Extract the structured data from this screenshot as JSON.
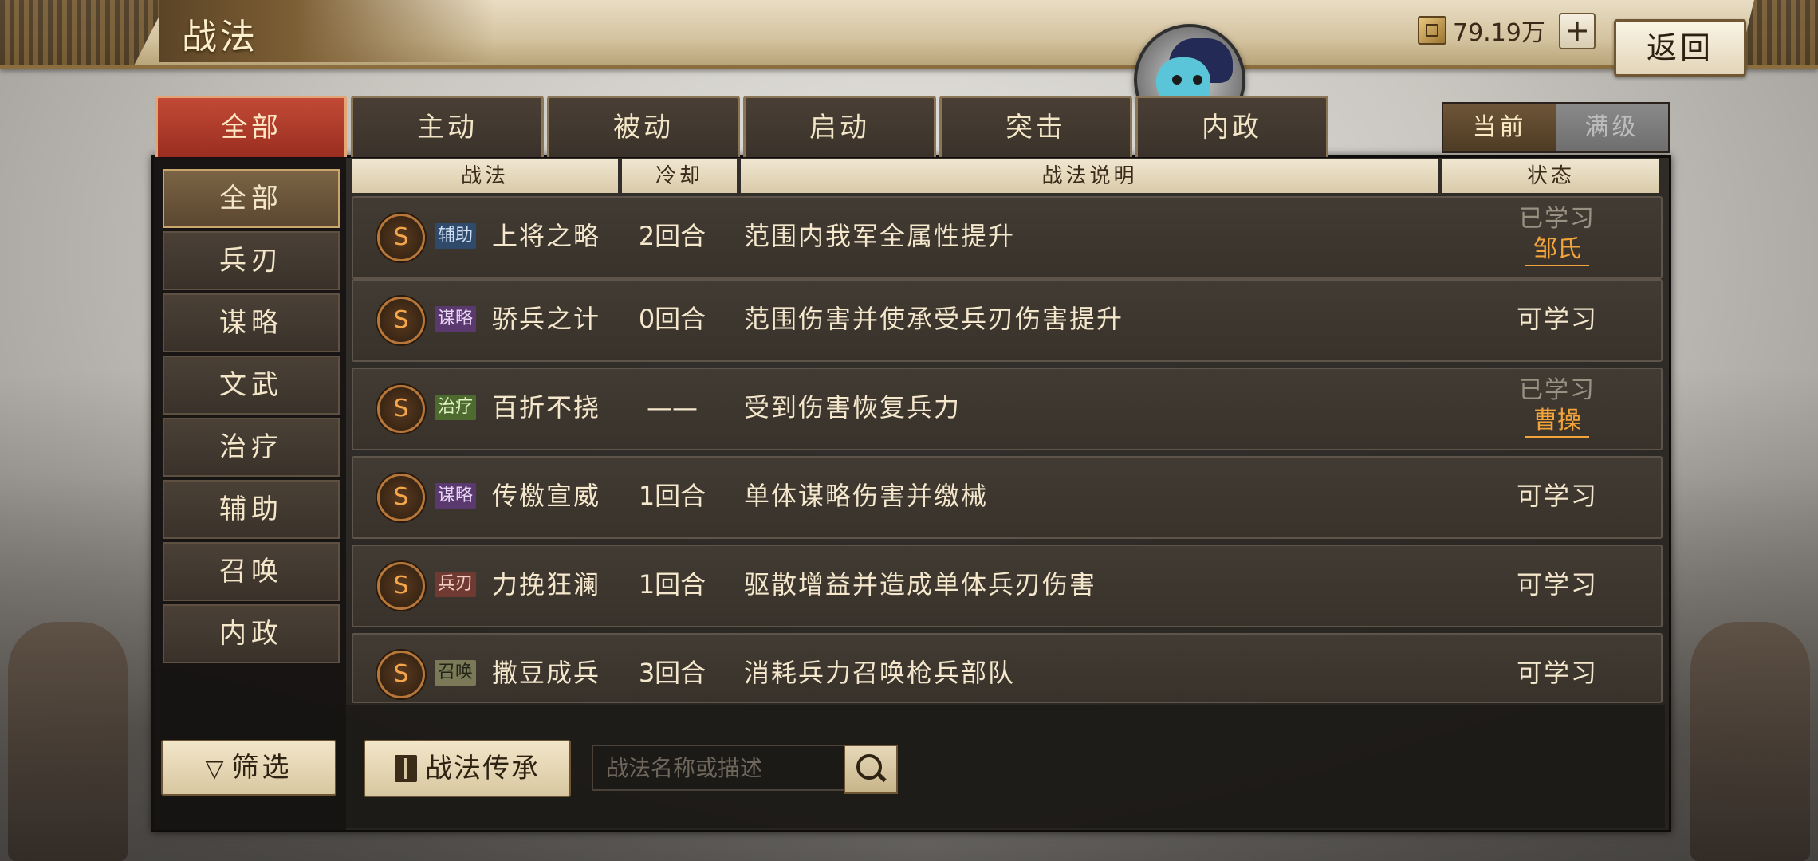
{
  "header": {
    "title": "战法",
    "currency_amount": "79.19万",
    "plus_label": "+",
    "back_label": "返回"
  },
  "tabs": [
    {
      "label": "全部",
      "active": true
    },
    {
      "label": "主动",
      "active": false
    },
    {
      "label": "被动",
      "active": false
    },
    {
      "label": "启动",
      "active": false
    },
    {
      "label": "突击",
      "active": false
    },
    {
      "label": "内政",
      "active": false
    }
  ],
  "view_toggle": {
    "current_label": "当前",
    "max_label": "满级",
    "selected": "当前"
  },
  "sidebar": {
    "items": [
      {
        "label": "全部",
        "active": true
      },
      {
        "label": "兵刃",
        "active": false
      },
      {
        "label": "谋略",
        "active": false
      },
      {
        "label": "文武",
        "active": false
      },
      {
        "label": "治疗",
        "active": false
      },
      {
        "label": "辅助",
        "active": false
      },
      {
        "label": "召唤",
        "active": false
      },
      {
        "label": "内政",
        "active": false
      }
    ],
    "filter_label": "筛选"
  },
  "table": {
    "columns": [
      "战法",
      "冷却",
      "战法说明",
      "状态"
    ],
    "rows": [
      {
        "grade": "S",
        "tag": "辅助",
        "tag_type": "assist",
        "name": "上将之略",
        "cooldown": "2回合",
        "desc": "范围内我军全属性提升",
        "status": "已学习",
        "learned_by": "邹氏"
      },
      {
        "grade": "S",
        "tag": "谋略",
        "tag_type": "strategy",
        "name": "骄兵之计",
        "cooldown": "0回合",
        "desc": "范围伤害并使承受兵刃伤害提升",
        "status": "可学习",
        "learned_by": ""
      },
      {
        "grade": "S",
        "tag": "治疗",
        "tag_type": "heal",
        "name": "百折不挠",
        "cooldown": "——",
        "desc": "受到伤害恢复兵力",
        "status": "已学习",
        "learned_by": "曹操"
      },
      {
        "grade": "S",
        "tag": "谋略",
        "tag_type": "strategy",
        "name": "传檄宣威",
        "cooldown": "1回合",
        "desc": "单体谋略伤害并缴械",
        "status": "可学习",
        "learned_by": ""
      },
      {
        "grade": "S",
        "tag": "兵刃",
        "tag_type": "blade",
        "name": "力挽狂澜",
        "cooldown": "1回合",
        "desc": "驱散增益并造成单体兵刃伤害",
        "status": "可学习",
        "learned_by": ""
      },
      {
        "grade": "S",
        "tag": "召唤",
        "tag_type": "summon",
        "name": "撒豆成兵",
        "cooldown": "3回合",
        "desc": "消耗兵力召唤枪兵部队",
        "status": "可学习",
        "learned_by": ""
      }
    ]
  },
  "bottom": {
    "inherit_label": "战法传承",
    "search_placeholder": "战法名称或描述",
    "search_value": ""
  },
  "icons": {
    "currency": "copper-coin-icon",
    "filter": "funnel-icon",
    "inherit": "book-icon",
    "search": "search-icon",
    "avatar": "mascot-avatar"
  },
  "colors": {
    "active_tab": "#b83a2a",
    "learned_by": "#f2a33a",
    "grade_badge": "#f5a64a"
  }
}
